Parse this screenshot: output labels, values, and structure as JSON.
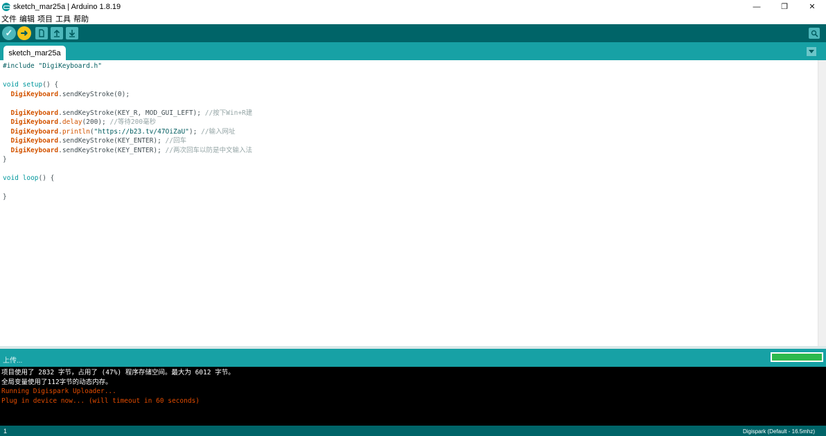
{
  "window": {
    "title": "sketch_mar25a | Arduino 1.8.19",
    "minimize": "—",
    "maximize": "❐",
    "close": "✕"
  },
  "menu": [
    "文件",
    "编辑",
    "项目",
    "工具",
    "帮助"
  ],
  "toolbar": {
    "verify_icon": "✓",
    "upload_icon": "➜",
    "icons": [
      "verify-icon",
      "upload-icon",
      "new-icon",
      "open-icon",
      "save-icon",
      "serial-monitor-icon"
    ]
  },
  "tabs": [
    {
      "label": "sketch_mar25a"
    }
  ],
  "code": {
    "l1": {
      "pre": "#include",
      "str": " \"DigiKeyboard.h\""
    },
    "l3": {
      "kw": "void",
      "fn": "setup",
      "rest": "() {"
    },
    "l4": {
      "cls": "DigiKeyboard",
      "rest": ".sendKeyStroke(0);"
    },
    "l6": {
      "cls": "DigiKeyboard",
      "rest": ".sendKeyStroke(KEY_R, MOD_GUI_LEFT); ",
      "cm": "//按下Win+R建"
    },
    "l7": {
      "cls": "DigiKeyboard",
      "dot": ".",
      "fn": "delay",
      "rest": "(200); ",
      "cm": "//等待200毫秒"
    },
    "l8": {
      "cls": "DigiKeyboard",
      "dot": ".",
      "fn": "println",
      "open": "(",
      "str": "\"https://b23.tv/47OiZaU\"",
      "rest": "); ",
      "cm": "//输入网址"
    },
    "l9": {
      "cls": "DigiKeyboard",
      "rest": ".sendKeyStroke(KEY_ENTER); ",
      "cm": "//回车"
    },
    "l10": {
      "cls": "DigiKeyboard",
      "rest": ".sendKeyStroke(KEY_ENTER); ",
      "cm": "//两次回车以防是中文输入法"
    },
    "l11": {
      "rest": "}"
    },
    "l13": {
      "kw": "void",
      "fn": "loop",
      "rest": "() {"
    },
    "l15": {
      "rest": "}"
    }
  },
  "status": {
    "message": "上传...",
    "progress": 1.0
  },
  "console": {
    "line1": "项目使用了 2832 字节，占用了 (47%) 程序存储空间。最大为 6012 字节。",
    "line2": "全局变量使用了112字节的动态内存。",
    "line3": "Running Digispark Uploader...",
    "line4": "Plug in device now... (will timeout in 60 seconds)"
  },
  "footer": {
    "line_number": "1",
    "board": "Digispark (Default - 16.5mhz)"
  },
  "colors": {
    "toolbar": "#006468",
    "tabbar": "#17a1a5",
    "upload_button": "#f5c518",
    "progress_fill": "#2db94d",
    "console_error": "#e34c00"
  }
}
